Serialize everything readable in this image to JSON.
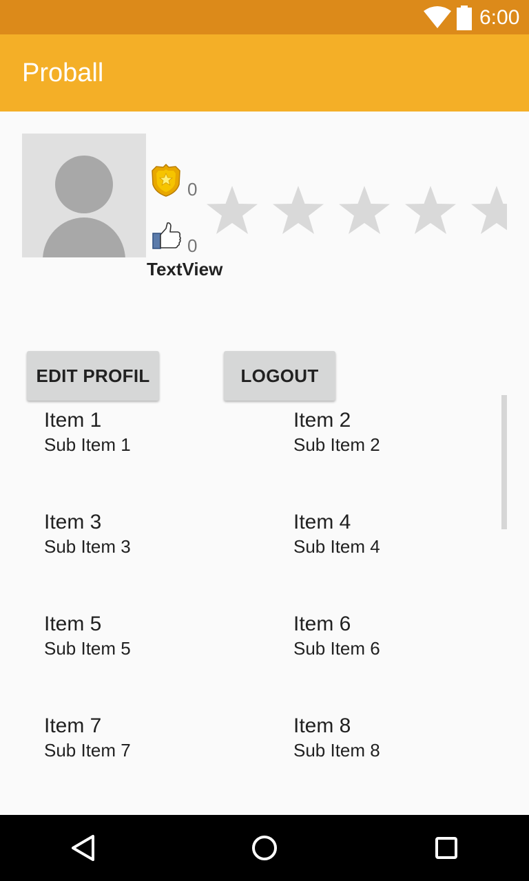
{
  "status_bar": {
    "time": "6:00",
    "icons": [
      "wifi-icon",
      "battery-icon"
    ],
    "color": "#dc8a1a"
  },
  "app_bar": {
    "title": "Proball",
    "color": "#f4af27"
  },
  "profile": {
    "avatar_icon": "avatar-placeholder-icon",
    "badge_icon": "police-badge-icon",
    "badge_count": "0",
    "like_icon": "thumbs-up-icon",
    "like_count": "0",
    "username": "TextView",
    "rating": 0,
    "rating_max": 5
  },
  "buttons": {
    "edit_label": "EDIT PROFIL",
    "logout_label": "LOGOUT"
  },
  "grid": {
    "items": [
      {
        "title": "Item 1",
        "subtitle": "Sub Item 1"
      },
      {
        "title": "Item 2",
        "subtitle": "Sub Item 2"
      },
      {
        "title": "Item 3",
        "subtitle": "Sub Item 3"
      },
      {
        "title": "Item 4",
        "subtitle": "Sub Item 4"
      },
      {
        "title": "Item 5",
        "subtitle": "Sub Item 5"
      },
      {
        "title": "Item 6",
        "subtitle": "Sub Item 6"
      },
      {
        "title": "Item 7",
        "subtitle": "Sub Item 7"
      },
      {
        "title": "Item 8",
        "subtitle": "Sub Item 8"
      }
    ]
  },
  "nav_bar": {
    "icons": [
      "back-icon",
      "home-icon",
      "recents-icon"
    ]
  }
}
